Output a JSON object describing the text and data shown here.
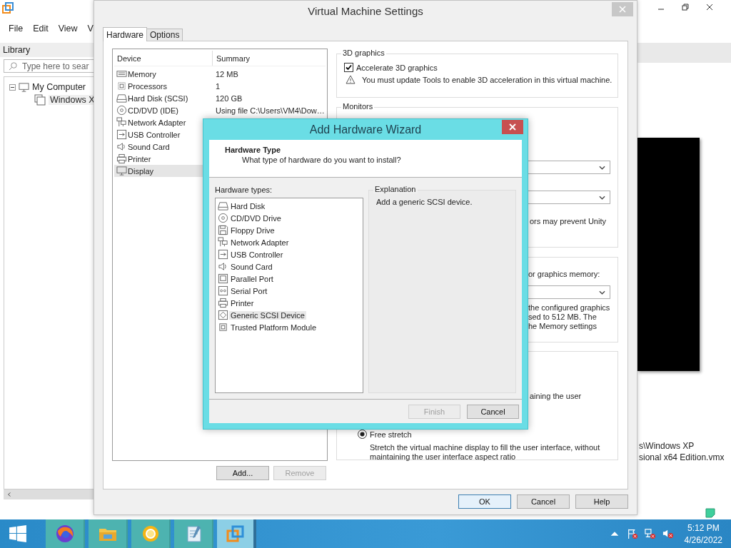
{
  "app": {
    "menu": [
      "File",
      "Edit",
      "View",
      "V"
    ],
    "library_label": "Library",
    "search": {
      "placeholder": "Type here to sear"
    },
    "tree": [
      {
        "label": "My Computer",
        "expanded": true,
        "children": [
          {
            "label": "Windows X"
          }
        ]
      }
    ],
    "vm_path": [
      "s\\Windows XP",
      "sional x64 Edition.vmx"
    ]
  },
  "settings": {
    "title": "Virtual Machine Settings",
    "tabs": [
      {
        "label": "Hardware",
        "selected": true
      },
      {
        "label": "Options",
        "selected": false
      }
    ],
    "columns": [
      "Device",
      "Summary"
    ],
    "devices": [
      {
        "name": "Memory",
        "kind": "memory",
        "summary": "12 MB",
        "selected": false
      },
      {
        "name": "Processors",
        "kind": "cpu",
        "summary": "1",
        "selected": false
      },
      {
        "name": "Hard Disk (SCSI)",
        "kind": "disk",
        "summary": "120 GB",
        "selected": false
      },
      {
        "name": "CD/DVD (IDE)",
        "kind": "cd",
        "summary": "Using file C:\\Users\\VM4\\Dow…",
        "selected": false
      },
      {
        "name": "Network Adapter",
        "kind": "network",
        "selected": false
      },
      {
        "name": "USB Controller",
        "kind": "usb",
        "selected": false
      },
      {
        "name": "Sound Card",
        "kind": "sound",
        "selected": false
      },
      {
        "name": "Printer",
        "kind": "printer",
        "selected": false
      },
      {
        "name": "Display",
        "kind": "display",
        "selected": true
      }
    ],
    "list_buttons": [
      {
        "label": "Add...",
        "disabled": false
      },
      {
        "label": "Remove",
        "disabled": true
      }
    ],
    "graphics_3d": {
      "legend": "3D graphics",
      "accelerate": {
        "label": "Accelerate 3D graphics",
        "checked": true
      },
      "warning": "You must update Tools to enable 3D acceleration in this virtual machine."
    },
    "monitors": {
      "legend": "Monitors",
      "note": "ors may prevent Unity"
    },
    "graphics_memory": {
      "label": "or graphics memory:",
      "note_lines": [
        "the configured graphics",
        "sed to 512 MB. The",
        "he Memory settings"
      ]
    },
    "scaling": {
      "fragment": "aining the user",
      "option": {
        "label": "Free stretch",
        "selected": true
      },
      "description": "Stretch the virtual machine display to fill the user interface, without maintaining the user interface aspect ratio"
    },
    "buttons": [
      {
        "label": "OK",
        "default": true
      },
      {
        "label": "Cancel",
        "default": false
      },
      {
        "label": "Help",
        "default": false
      }
    ]
  },
  "wizard": {
    "title": "Add Hardware Wizard",
    "heading": "Hardware Type",
    "subheading": "What type of hardware do you want to install?",
    "list_label": "Hardware types:",
    "types": [
      {
        "label": "Hard Disk",
        "kind": "disk",
        "selected": false
      },
      {
        "label": "CD/DVD Drive",
        "kind": "cd",
        "selected": false
      },
      {
        "label": "Floppy Drive",
        "kind": "floppy",
        "selected": false
      },
      {
        "label": "Network Adapter",
        "kind": "network",
        "selected": false
      },
      {
        "label": "USB Controller",
        "kind": "usb",
        "selected": false
      },
      {
        "label": "Sound Card",
        "kind": "sound",
        "selected": false
      },
      {
        "label": "Parallel Port",
        "kind": "parallel",
        "selected": false
      },
      {
        "label": "Serial Port",
        "kind": "serial",
        "selected": false
      },
      {
        "label": "Printer",
        "kind": "printer",
        "selected": false
      },
      {
        "label": "Generic SCSI Device",
        "kind": "scsi",
        "selected": true
      },
      {
        "label": "Trusted Platform Module",
        "kind": "tpm",
        "selected": false
      }
    ],
    "explanation_legend": "Explanation",
    "explanation": "Add a generic SCSI device.",
    "buttons": [
      {
        "label": "Finish",
        "disabled": true
      },
      {
        "label": "Cancel",
        "disabled": false
      }
    ]
  },
  "taskbar": {
    "apps": [
      {
        "kind": "browser",
        "selected": false
      },
      {
        "kind": "folder",
        "selected": false
      },
      {
        "kind": "ring",
        "selected": false
      },
      {
        "kind": "notepad",
        "selected": false
      },
      {
        "kind": "vm",
        "selected": true
      }
    ],
    "time": "5:12 PM",
    "date": "4/26/2022"
  }
}
